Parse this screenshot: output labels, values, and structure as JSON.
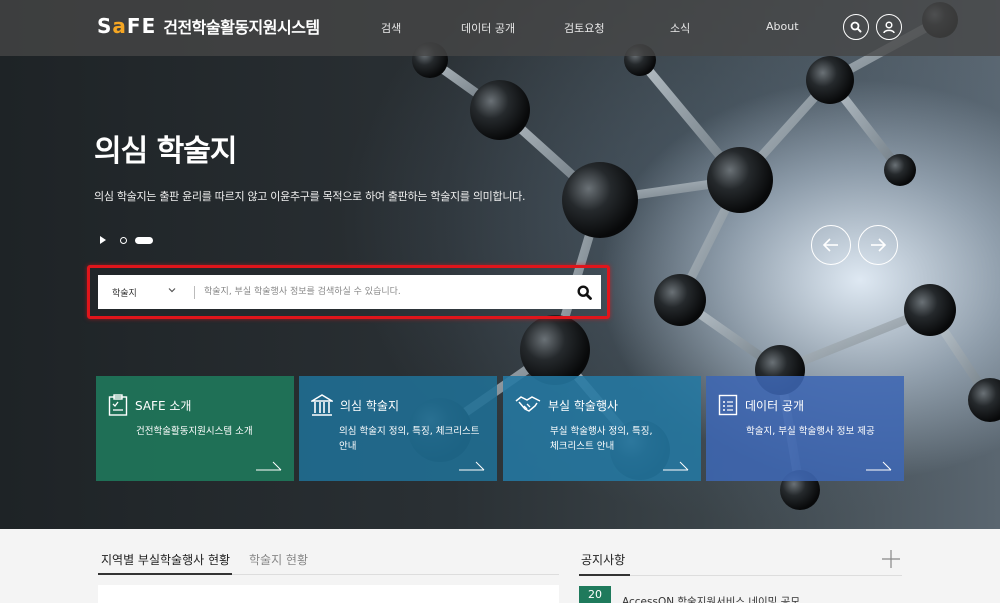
{
  "header": {
    "logo_mark_s": "S",
    "logo_mark_a": "a",
    "logo_mark_fe": "FE",
    "logo_text": "건전학술활동지원시스템",
    "nav": [
      "검색",
      "데이터 공개",
      "검토요청",
      "소식",
      "About"
    ]
  },
  "hero": {
    "title": "의심 학술지",
    "description": "의심 학술지는 출판 윤리를 따르지 않고 이윤추구를 목적으로 하여 출판하는 학술지를 의미합니다."
  },
  "search": {
    "category": "학술지",
    "placeholder": "학술지, 부실 학술행사 정보를 검색하실 수 있습니다."
  },
  "cards": [
    {
      "title": "SAFE 소개",
      "desc_lines": [
        "건전학술활동지원시스템 소개"
      ],
      "color": "#1f7a5c"
    },
    {
      "title": "의심 학술지",
      "desc_lines": [
        "의심 학술지 정의, 특징, 체크리스트",
        "안내"
      ],
      "color": "#206f95"
    },
    {
      "title": "부실 학술행사",
      "desc_lines": [
        "부실 학술행사 정의, 특징,",
        "체크리스트 안내"
      ],
      "color": "#2479a3"
    },
    {
      "title": "데이터 공개",
      "desc_lines": [
        "학술지, 부실 학술행사 정보 제공"
      ],
      "color": "#3d67b3"
    }
  ],
  "bottom": {
    "tabs": [
      "지역별 부실학술행사 현황",
      "학술지 현황"
    ],
    "notice_title": "공지사항",
    "notice_items": [
      {
        "day": "20",
        "text": "AccessON 학술지원서비스 네이밍 공모"
      }
    ]
  }
}
